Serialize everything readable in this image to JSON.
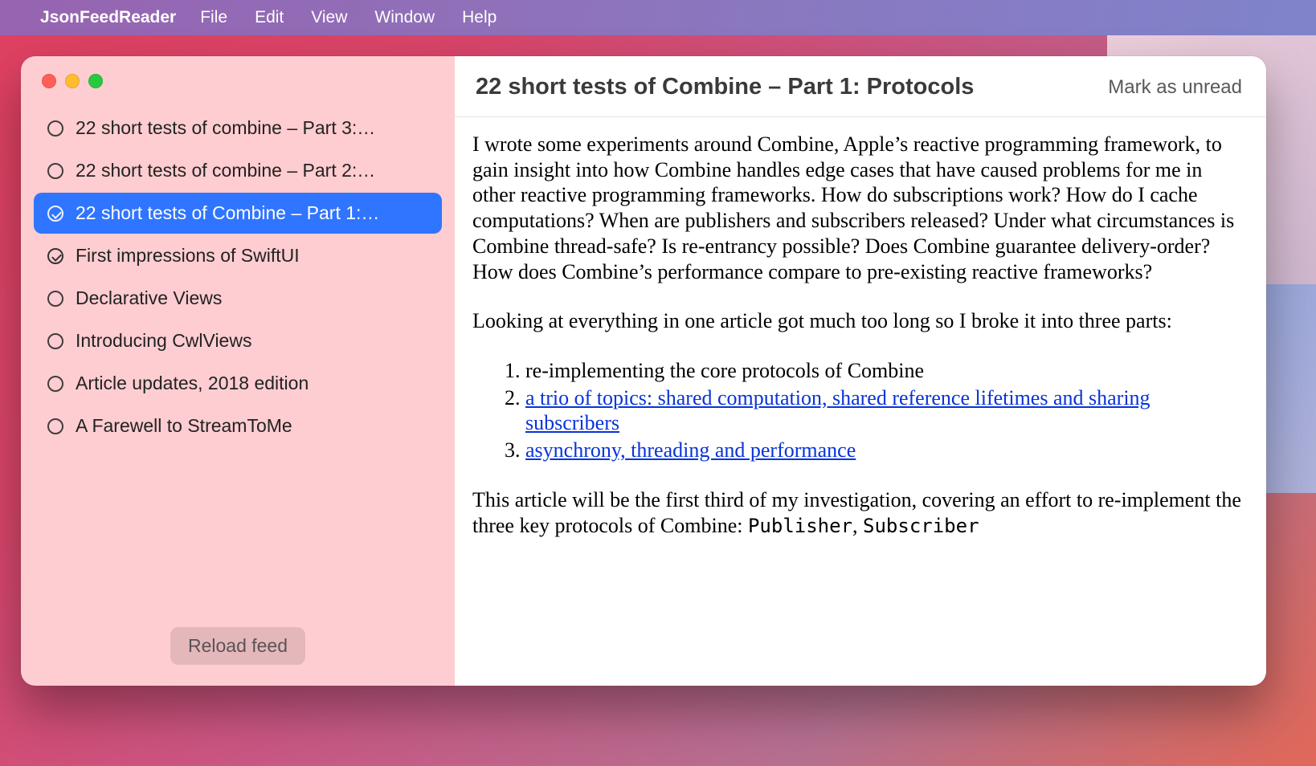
{
  "menubar": {
    "app_name": "JsonFeedReader",
    "items": [
      "File",
      "Edit",
      "View",
      "Window",
      "Help"
    ]
  },
  "sidebar": {
    "items": [
      {
        "label": "22 short tests of combine – Part 3:…",
        "read": false,
        "selected": false
      },
      {
        "label": "22 short tests of combine – Part 2:…",
        "read": false,
        "selected": false
      },
      {
        "label": "22 short tests of Combine – Part 1:…",
        "read": true,
        "selected": true
      },
      {
        "label": "First impressions of SwiftUI",
        "read": true,
        "selected": false
      },
      {
        "label": "Declarative Views",
        "read": false,
        "selected": false
      },
      {
        "label": "Introducing CwlViews",
        "read": false,
        "selected": false
      },
      {
        "label": "Article updates, 2018 edition",
        "read": false,
        "selected": false
      },
      {
        "label": "A Farewell to StreamToMe",
        "read": false,
        "selected": false
      }
    ],
    "reload_label": "Reload feed"
  },
  "content": {
    "title": "22 short tests of Combine – Part 1: Protocols",
    "mark_unread_label": "Mark as unread",
    "p1": "I wrote some experiments around Combine, Apple’s reactive programming framework, to gain insight into how Combine handles edge cases that have caused problems for me in other reactive programming frameworks. How do subscriptions work? How do I cache computations? When are publishers and subscribers released? Under what circumstances is Combine thread-safe? Is re-entrancy possible? Does Combine guarantee delivery-order? How does Combine’s performance compare to pre-existing reactive frameworks?",
    "p2": "Looking at everything in one article got much too long so I broke it into three parts:",
    "list": {
      "i1": "re-implementing the core protocols of Combine",
      "i2": "a trio of topics: shared computation, shared reference lifetimes and sharing subscribers",
      "i3": "asynchrony, threading and performance"
    },
    "p3_pre": "This article will be the first third of my investigation, covering an effort to re-implement the three key protocols of Combine: ",
    "code1": "Publisher",
    "sep": ", ",
    "code2": "Subscriber"
  }
}
